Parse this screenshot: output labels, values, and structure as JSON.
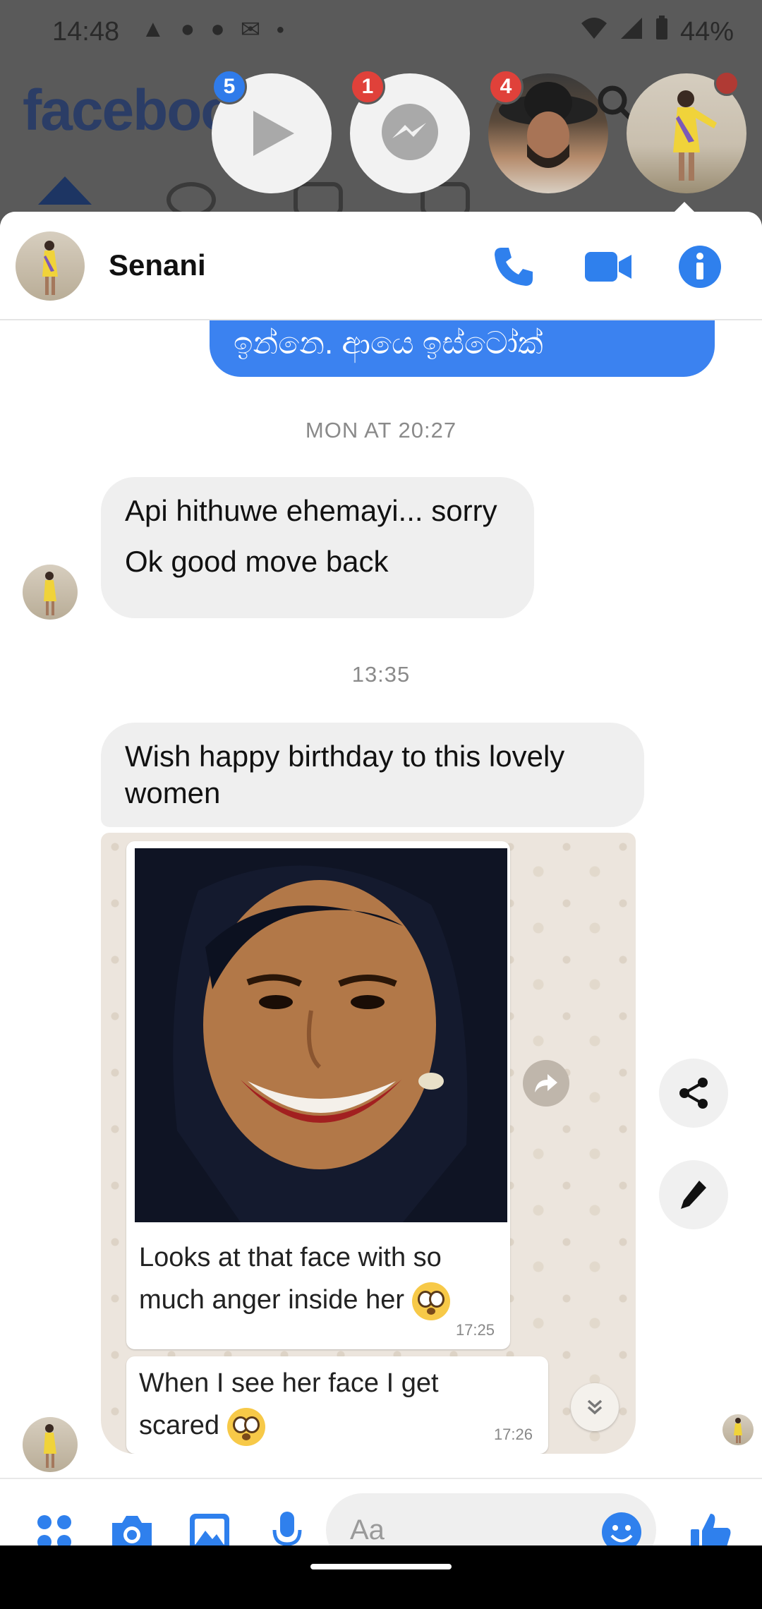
{
  "status_bar": {
    "time": "14:48",
    "battery": "44%"
  },
  "background_app": {
    "logo": "facebook"
  },
  "chat_heads": [
    {
      "type": "video",
      "badge": "5",
      "badge_color": "#2f7bea"
    },
    {
      "type": "messenger",
      "badge": "1",
      "badge_color": "#e0413a"
    },
    {
      "type": "contact",
      "badge": "4",
      "badge_color": "#e0413a"
    },
    {
      "type": "contact-active",
      "badge": "",
      "badge_color": "#e0413a"
    }
  ],
  "chat_header": {
    "name": "Senani"
  },
  "messages": {
    "outgoing_partial": "ඉන්නෙ. ආයෙ ඉස්ටෝක්",
    "timestamp_1": "MON AT 20:27",
    "incoming_1_line1": "Api hithuwe ehemayi... sorry",
    "incoming_1_line2": "Ok good move back",
    "timestamp_2": "13:35",
    "incoming_2": "Wish happy birthday to this lovely women",
    "attachment": {
      "caption_1": "Looks at that face with so much anger inside her",
      "time_1": "17:25",
      "caption_2": "When I see her face I get scared",
      "time_2": "17:26"
    }
  },
  "composer": {
    "placeholder": "Aa"
  },
  "colors": {
    "messenger_blue": "#3b82f0",
    "icon_blue": "#2f80ed",
    "bubble_gray": "#efefef"
  }
}
